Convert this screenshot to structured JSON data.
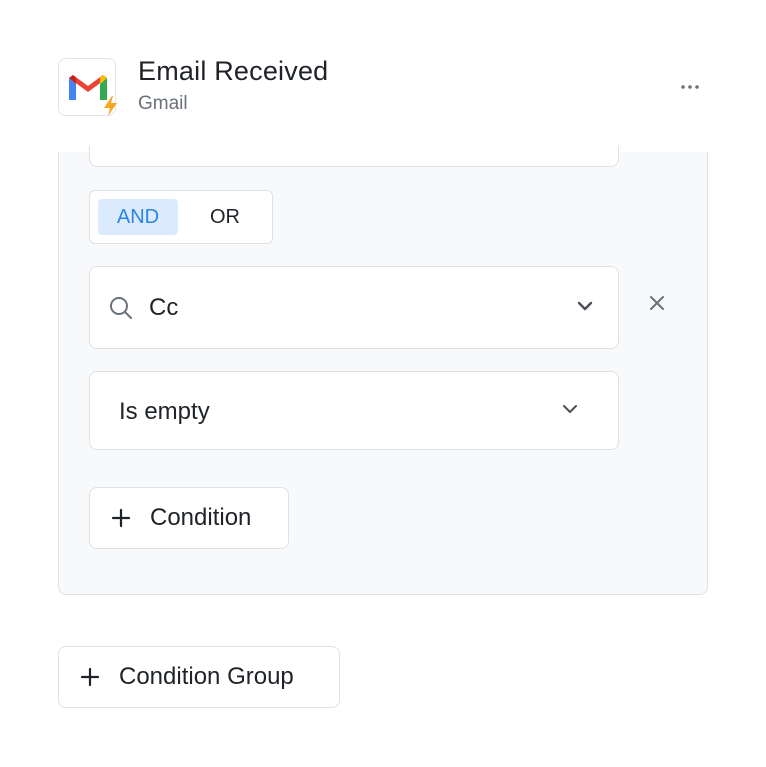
{
  "trigger": {
    "title": "Email Received",
    "app_name": "Gmail",
    "icon": "gmail-icon",
    "badge_icon": "lightning-icon",
    "more_icon": "more-horizontal-icon"
  },
  "filter": {
    "logic_toggle": {
      "options": [
        "AND",
        "OR"
      ],
      "selected": "AND"
    },
    "condition": {
      "field_value": "Cc",
      "operator_value": "Is empty"
    },
    "add_condition_label": "Condition"
  },
  "add_group_label": "Condition Group",
  "colors": {
    "accent": "#2a84ea",
    "accent_bg": "#dbeafd",
    "gmail_red": "#ea4335",
    "gmail_blue": "#4285f4",
    "gmail_green": "#34a853",
    "gmail_yellow": "#fbbc04",
    "bolt_orange": "#f5a623"
  }
}
